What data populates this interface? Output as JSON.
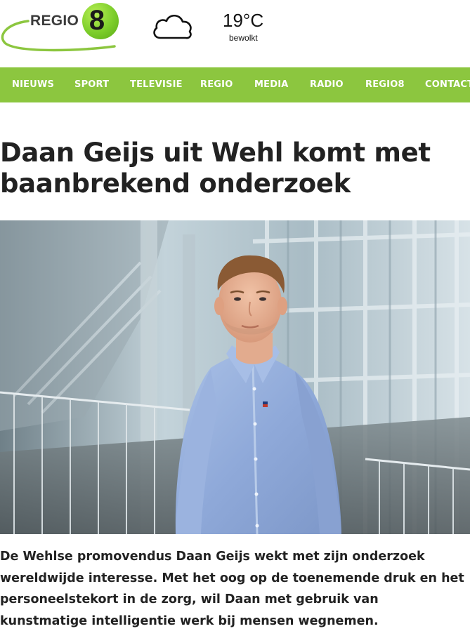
{
  "header": {
    "logo": {
      "word": "REGIO",
      "digit": "8",
      "brand_color": "#8cc63f"
    },
    "weather": {
      "icon": "cloud-icon",
      "temperature": "19°C",
      "description": "bewolkt"
    }
  },
  "nav": {
    "background": "#8cc63f",
    "items": [
      {
        "label": "NIEUWS"
      },
      {
        "label": "SPORT"
      },
      {
        "label": "TELEVISIE"
      },
      {
        "label": "REGIO"
      },
      {
        "label": "MEDIA"
      },
      {
        "label": "RADIO"
      },
      {
        "label": "REGIO8"
      },
      {
        "label": "CONTACT"
      }
    ]
  },
  "article": {
    "title_line1": "Daan Geijs uit Wehl komt met",
    "title_line2": "baanbrekend onderzoek",
    "intro": [
      "De Wehlse promovendus Daan Geijs wekt met zijn onderzoek",
      "wereldwijde interesse. Met het oog op de toenemende druk en het",
      "personeelstekort in de zorg, wil Daan met gebruik van",
      "kunstmatige intelligentie werk bij mensen wegnemen."
    ]
  }
}
